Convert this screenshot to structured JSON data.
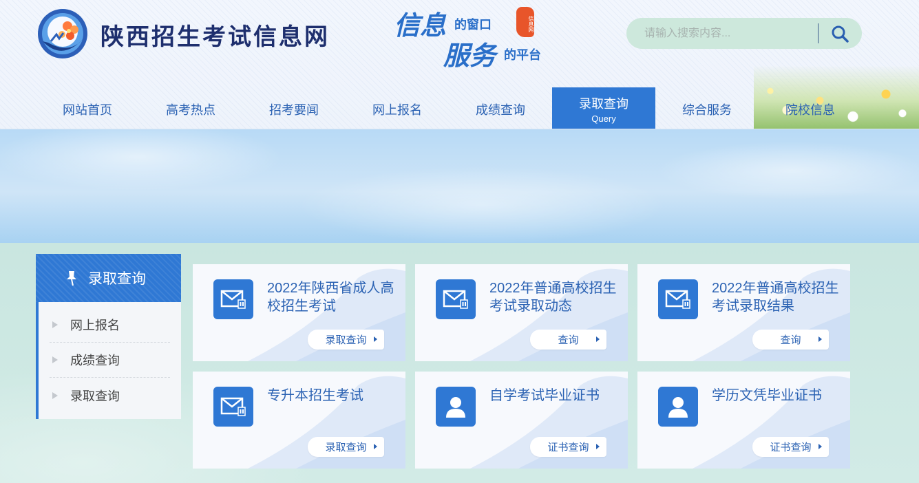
{
  "header": {
    "site_title": "陕西招生考试信息网",
    "slogan": {
      "word1": "信息",
      "word2": "的窗口",
      "word3": "服务",
      "word4": "的平台",
      "seal": "信息网"
    }
  },
  "search": {
    "placeholder": "请输入搜索内容..."
  },
  "nav": {
    "items": [
      {
        "label": "网站首页"
      },
      {
        "label": "高考热点"
      },
      {
        "label": "招考要闻"
      },
      {
        "label": "网上报名"
      },
      {
        "label": "成绩查询"
      },
      {
        "label": "录取查询",
        "sub": "Query"
      },
      {
        "label": "综合服务"
      },
      {
        "label": "院校信息"
      }
    ]
  },
  "sidebar": {
    "title": "录取查询",
    "items": [
      {
        "label": "网上报名"
      },
      {
        "label": "成绩查询"
      },
      {
        "label": "录取查询"
      }
    ]
  },
  "cards": [
    {
      "title": "2022年陕西省成人高校招生考试",
      "link": "录取查询",
      "icon": "mail-icon"
    },
    {
      "title": "2022年普通高校招生考试录取动态",
      "link": "查询",
      "icon": "mail-icon"
    },
    {
      "title": "2022年普通高校招生考试录取结果",
      "link": "查询",
      "icon": "mail-icon"
    },
    {
      "title": "专升本招生考试",
      "link": "录取查询",
      "icon": "mail-icon"
    },
    {
      "title": "自学考试毕业证书",
      "link": "证书查询",
      "icon": "person-icon"
    },
    {
      "title": "学历文凭毕业证书",
      "link": "证书查询",
      "icon": "person-icon"
    }
  ],
  "colors": {
    "primary": "#2f78d4",
    "text_blue": "#2b62b3",
    "title_navy": "#1e2f6e"
  }
}
